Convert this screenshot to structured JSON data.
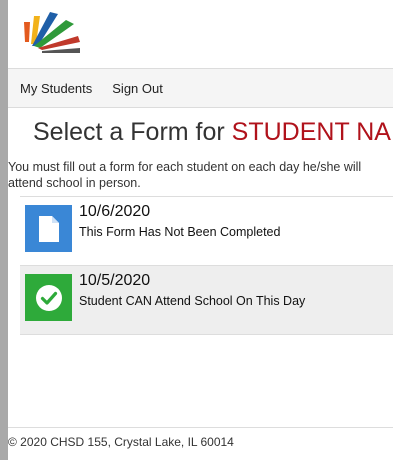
{
  "nav": {
    "my_students": "My Students",
    "sign_out": "Sign Out"
  },
  "title": {
    "prefix": "Select a Form for ",
    "student_name": "STUDENT NAME"
  },
  "instructions": "You must fill out a form for each student on each day he/she will attend school in person.",
  "forms": [
    {
      "date": "10/6/2020",
      "status": "This Form Has Not Been Completed",
      "icon": "document-icon",
      "color": "#3a87d6"
    },
    {
      "date": "10/5/2020",
      "status": "Student CAN Attend School On This Day",
      "icon": "check-icon",
      "color": "#2eaa3a"
    }
  ],
  "footer": "© 2020 CHSD 155, Crystal Lake, IL 60014",
  "colors": {
    "accent_red": "#b0121b",
    "background": "#a9a9a9"
  }
}
